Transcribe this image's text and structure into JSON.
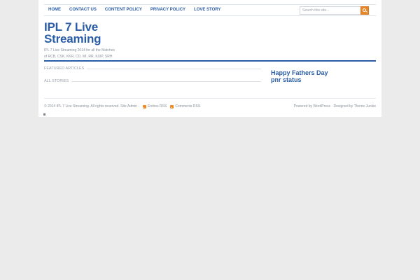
{
  "nav": {
    "items": [
      {
        "label": "HOME"
      },
      {
        "label": "CONTACT US"
      },
      {
        "label": "CONTENT POLICY"
      },
      {
        "label": "PRIVACY POLICY"
      },
      {
        "label": "LOVE STORY"
      }
    ]
  },
  "search": {
    "placeholder": "Search this site...",
    "icon": "search-icon",
    "button_color": "#e8872a"
  },
  "site": {
    "title_line1": "IPL 7 Live",
    "title_line2": "Streaming",
    "description_line1": "IPL 7 Live Streaming 2014 for all the Matches",
    "description_line2": "of RCB, CSK, KKR, CD, MI, RR, KXIP, SRH",
    "accent_color": "#2b5da7"
  },
  "sections": {
    "featured": "FEATURED ARTICLES",
    "all": "ALL STORIES"
  },
  "sidebar": {
    "links": [
      {
        "label": "Happy Fathers Day"
      },
      {
        "label": "pnr status"
      }
    ]
  },
  "footer": {
    "copyright": "© 2014 IPL 7 Live Streaming. All rights reserved. Site Admin ·",
    "entries_rss": "Entries RSS",
    "comments_rss": "Comments RSS",
    "credits": "Powered by WordPress · Designed by Theme Junkie"
  }
}
